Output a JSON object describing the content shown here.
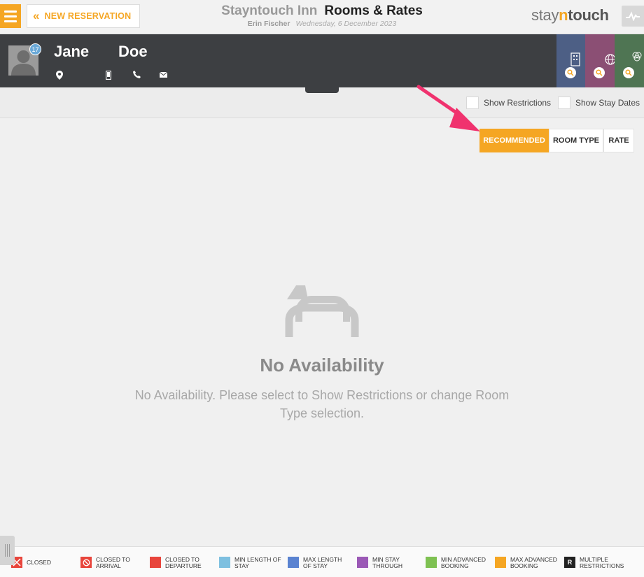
{
  "header": {
    "new_reservation_label": "NEW RESERVATION",
    "hotel_name": "Stayntouch Inn",
    "page_title": "Rooms & Rates",
    "user_name": "Erin Fischer",
    "business_date": "Wednesday, 6 December 2023",
    "logo": {
      "part1": "stay",
      "part2": "n",
      "part3": "touch"
    }
  },
  "guest": {
    "first_name": "Jane",
    "last_name": "Doe",
    "badge_count": "17",
    "icons": [
      "location-icon",
      "mobile-icon",
      "phone-icon",
      "email-icon"
    ]
  },
  "options": {
    "show_restrictions_label": "Show Restrictions",
    "show_stay_dates_label": "Show Stay Dates"
  },
  "tabs": [
    {
      "label": "RECOMMENDED",
      "active": true
    },
    {
      "label": "ROOM TYPE",
      "active": false
    },
    {
      "label": "RATE",
      "active": false
    }
  ],
  "empty_state": {
    "title": "No Availability",
    "message": "No Availability. Please select to Show Restrictions or change Room Type selection."
  },
  "legend": [
    {
      "label": "CLOSED",
      "color": "#e8453c",
      "icon": "x-icon"
    },
    {
      "label": "CLOSED TO ARRIVAL",
      "color": "#e8453c",
      "icon": "no-entry-icon"
    },
    {
      "label": "CLOSED TO DEPARTURE",
      "color": "#e8453c",
      "icon": ""
    },
    {
      "label": "MIN LENGTH OF STAY",
      "color": "#7ec0e0",
      "icon": ""
    },
    {
      "label": "MAX LENGTH OF STAY",
      "color": "#5a83d1",
      "icon": ""
    },
    {
      "label": "MIN STAY THROUGH",
      "color": "#9b59b6",
      "icon": ""
    },
    {
      "label": "MIN ADVANCED BOOKING",
      "color": "#7ec152",
      "icon": ""
    },
    {
      "label": "MAX ADVANCED BOOKING",
      "color": "#f5a623",
      "icon": ""
    },
    {
      "label": "MULTIPLE RESTRICTIONS",
      "color": "#222222",
      "icon": "R"
    }
  ],
  "colors": {
    "accent": "#f5a623",
    "dark_header": "#3d3f42",
    "annotation_arrow": "#f0326e"
  }
}
